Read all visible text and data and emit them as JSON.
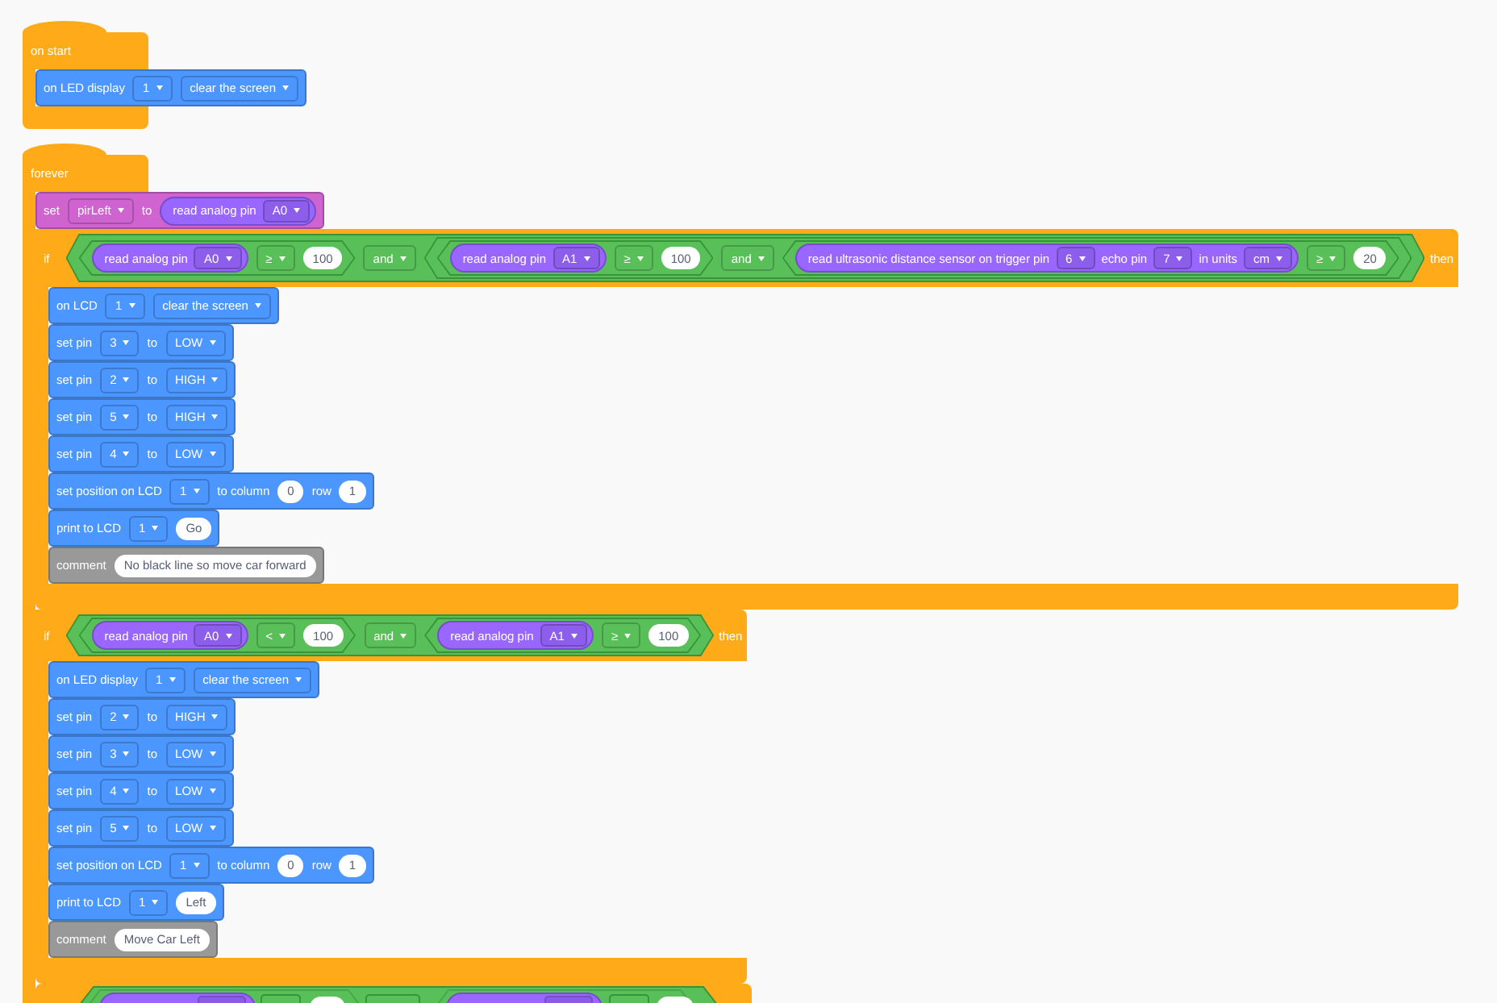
{
  "scripts": [
    {
      "kind": "hat",
      "label": "on start",
      "closed": true,
      "body": [
        {
          "kind": "command",
          "color": "#4c97ff",
          "parts": [
            {
              "kind": "label",
              "text": "on LED display"
            },
            {
              "kind": "dropdown",
              "value": "1"
            },
            {
              "kind": "dropdown",
              "value": "clear the screen"
            }
          ]
        }
      ]
    },
    {
      "kind": "hat",
      "label": "forever",
      "closed": false,
      "body": [
        {
          "kind": "command",
          "color": "#cf63cf",
          "parts": [
            {
              "kind": "label",
              "text": "set"
            },
            {
              "kind": "dropdown",
              "value": "pirLeft"
            },
            {
              "kind": "label",
              "text": "to"
            },
            {
              "kind": "reporter",
              "parts": [
                {
                  "kind": "label",
                  "text": "read analog pin"
                },
                {
                  "kind": "dropdown",
                  "value": "A0"
                }
              ]
            }
          ]
        },
        {
          "kind": "if",
          "label": "if",
          "then": "then",
          "condition": {
            "kind": "boolean",
            "parts": [
              {
                "kind": "boolean",
                "parts": [
                  {
                    "kind": "reporter",
                    "parts": [
                      {
                        "kind": "label",
                        "text": "read analog pin"
                      },
                      {
                        "kind": "dropdown",
                        "value": "A0"
                      }
                    ]
                  },
                  {
                    "kind": "dropdown",
                    "value": "≥"
                  },
                  {
                    "kind": "number",
                    "value": "100"
                  }
                ]
              },
              {
                "kind": "dropdown",
                "value": "and"
              },
              {
                "kind": "boolean",
                "parts": [
                  {
                    "kind": "boolean",
                    "parts": [
                      {
                        "kind": "reporter",
                        "parts": [
                          {
                            "kind": "label",
                            "text": "read analog pin"
                          },
                          {
                            "kind": "dropdown",
                            "value": "A1"
                          }
                        ]
                      },
                      {
                        "kind": "dropdown",
                        "value": "≥"
                      },
                      {
                        "kind": "number",
                        "value": "100"
                      }
                    ]
                  },
                  {
                    "kind": "dropdown",
                    "value": "and"
                  },
                  {
                    "kind": "boolean",
                    "parts": [
                      {
                        "kind": "reporter",
                        "parts": [
                          {
                            "kind": "label",
                            "text": "read ultrasonic distance sensor on trigger pin"
                          },
                          {
                            "kind": "dropdown",
                            "value": "6"
                          },
                          {
                            "kind": "label",
                            "text": "echo pin"
                          },
                          {
                            "kind": "dropdown",
                            "value": "7"
                          },
                          {
                            "kind": "label",
                            "text": "in units"
                          },
                          {
                            "kind": "dropdown",
                            "value": "cm"
                          }
                        ]
                      },
                      {
                        "kind": "dropdown",
                        "value": "≥"
                      },
                      {
                        "kind": "number",
                        "value": "20"
                      }
                    ]
                  }
                ]
              }
            ]
          },
          "body": [
            {
              "kind": "command",
              "color": "#4c97ff",
              "parts": [
                {
                  "kind": "label",
                  "text": "on LCD"
                },
                {
                  "kind": "dropdown",
                  "value": "1"
                },
                {
                  "kind": "dropdown",
                  "value": "clear the screen"
                }
              ]
            },
            {
              "kind": "command",
              "color": "#4c97ff",
              "parts": [
                {
                  "kind": "label",
                  "text": "set pin"
                },
                {
                  "kind": "dropdown",
                  "value": "3"
                },
                {
                  "kind": "label",
                  "text": "to"
                },
                {
                  "kind": "dropdown",
                  "value": "LOW"
                }
              ]
            },
            {
              "kind": "command",
              "color": "#4c97ff",
              "parts": [
                {
                  "kind": "label",
                  "text": "set pin"
                },
                {
                  "kind": "dropdown",
                  "value": "2"
                },
                {
                  "kind": "label",
                  "text": "to"
                },
                {
                  "kind": "dropdown",
                  "value": "HIGH"
                }
              ]
            },
            {
              "kind": "command",
              "color": "#4c97ff",
              "parts": [
                {
                  "kind": "label",
                  "text": "set pin"
                },
                {
                  "kind": "dropdown",
                  "value": "5"
                },
                {
                  "kind": "label",
                  "text": "to"
                },
                {
                  "kind": "dropdown",
                  "value": "HIGH"
                }
              ]
            },
            {
              "kind": "command",
              "color": "#4c97ff",
              "parts": [
                {
                  "kind": "label",
                  "text": "set pin"
                },
                {
                  "kind": "dropdown",
                  "value": "4"
                },
                {
                  "kind": "label",
                  "text": "to"
                },
                {
                  "kind": "dropdown",
                  "value": "LOW"
                }
              ]
            },
            {
              "kind": "command",
              "color": "#4c97ff",
              "parts": [
                {
                  "kind": "label",
                  "text": "set position on LCD"
                },
                {
                  "kind": "dropdown",
                  "value": "1"
                },
                {
                  "kind": "label",
                  "text": "to column"
                },
                {
                  "kind": "number",
                  "value": "0"
                },
                {
                  "kind": "label",
                  "text": "row"
                },
                {
                  "kind": "number",
                  "value": "1"
                }
              ]
            },
            {
              "kind": "command",
              "color": "#4c97ff",
              "parts": [
                {
                  "kind": "label",
                  "text": "print to LCD"
                },
                {
                  "kind": "dropdown",
                  "value": "1"
                },
                {
                  "kind": "text",
                  "value": "Go"
                }
              ]
            },
            {
              "kind": "command",
              "color": "#999999",
              "parts": [
                {
                  "kind": "label",
                  "text": "comment"
                },
                {
                  "kind": "text",
                  "value": "No black line so move car forward"
                }
              ]
            }
          ]
        },
        {
          "kind": "if",
          "label": "if",
          "then": "then",
          "condition": {
            "kind": "boolean",
            "parts": [
              {
                "kind": "boolean",
                "parts": [
                  {
                    "kind": "reporter",
                    "parts": [
                      {
                        "kind": "label",
                        "text": "read analog pin"
                      },
                      {
                        "kind": "dropdown",
                        "value": "A0"
                      }
                    ]
                  },
                  {
                    "kind": "dropdown",
                    "value": "<"
                  },
                  {
                    "kind": "number",
                    "value": "100"
                  }
                ]
              },
              {
                "kind": "dropdown",
                "value": "and"
              },
              {
                "kind": "boolean",
                "parts": [
                  {
                    "kind": "reporter",
                    "parts": [
                      {
                        "kind": "label",
                        "text": "read analog pin"
                      },
                      {
                        "kind": "dropdown",
                        "value": "A1"
                      }
                    ]
                  },
                  {
                    "kind": "dropdown",
                    "value": "≥"
                  },
                  {
                    "kind": "number",
                    "value": "100"
                  }
                ]
              }
            ]
          },
          "body": [
            {
              "kind": "command",
              "color": "#4c97ff",
              "parts": [
                {
                  "kind": "label",
                  "text": "on LED display"
                },
                {
                  "kind": "dropdown",
                  "value": "1"
                },
                {
                  "kind": "dropdown",
                  "value": "clear the screen"
                }
              ]
            },
            {
              "kind": "command",
              "color": "#4c97ff",
              "parts": [
                {
                  "kind": "label",
                  "text": "set pin"
                },
                {
                  "kind": "dropdown",
                  "value": "2"
                },
                {
                  "kind": "label",
                  "text": "to"
                },
                {
                  "kind": "dropdown",
                  "value": "HIGH"
                }
              ]
            },
            {
              "kind": "command",
              "color": "#4c97ff",
              "parts": [
                {
                  "kind": "label",
                  "text": "set pin"
                },
                {
                  "kind": "dropdown",
                  "value": "3"
                },
                {
                  "kind": "label",
                  "text": "to"
                },
                {
                  "kind": "dropdown",
                  "value": "LOW"
                }
              ]
            },
            {
              "kind": "command",
              "color": "#4c97ff",
              "parts": [
                {
                  "kind": "label",
                  "text": "set pin"
                },
                {
                  "kind": "dropdown",
                  "value": "4"
                },
                {
                  "kind": "label",
                  "text": "to"
                },
                {
                  "kind": "dropdown",
                  "value": "LOW"
                }
              ]
            },
            {
              "kind": "command",
              "color": "#4c97ff",
              "parts": [
                {
                  "kind": "label",
                  "text": "set pin"
                },
                {
                  "kind": "dropdown",
                  "value": "5"
                },
                {
                  "kind": "label",
                  "text": "to"
                },
                {
                  "kind": "dropdown",
                  "value": "LOW"
                }
              ]
            },
            {
              "kind": "command",
              "color": "#4c97ff",
              "parts": [
                {
                  "kind": "label",
                  "text": "set position on LCD"
                },
                {
                  "kind": "dropdown",
                  "value": "1"
                },
                {
                  "kind": "label",
                  "text": "to column"
                },
                {
                  "kind": "number",
                  "value": "0"
                },
                {
                  "kind": "label",
                  "text": "row"
                },
                {
                  "kind": "number",
                  "value": "1"
                }
              ]
            },
            {
              "kind": "command",
              "color": "#4c97ff",
              "parts": [
                {
                  "kind": "label",
                  "text": "print to LCD"
                },
                {
                  "kind": "dropdown",
                  "value": "1"
                },
                {
                  "kind": "text",
                  "value": "Left"
                }
              ]
            },
            {
              "kind": "command",
              "color": "#999999",
              "parts": [
                {
                  "kind": "label",
                  "text": "comment"
                },
                {
                  "kind": "text",
                  "value": "Move Car Left"
                }
              ]
            }
          ]
        },
        {
          "kind": "if_partial"
        }
      ]
    }
  ]
}
